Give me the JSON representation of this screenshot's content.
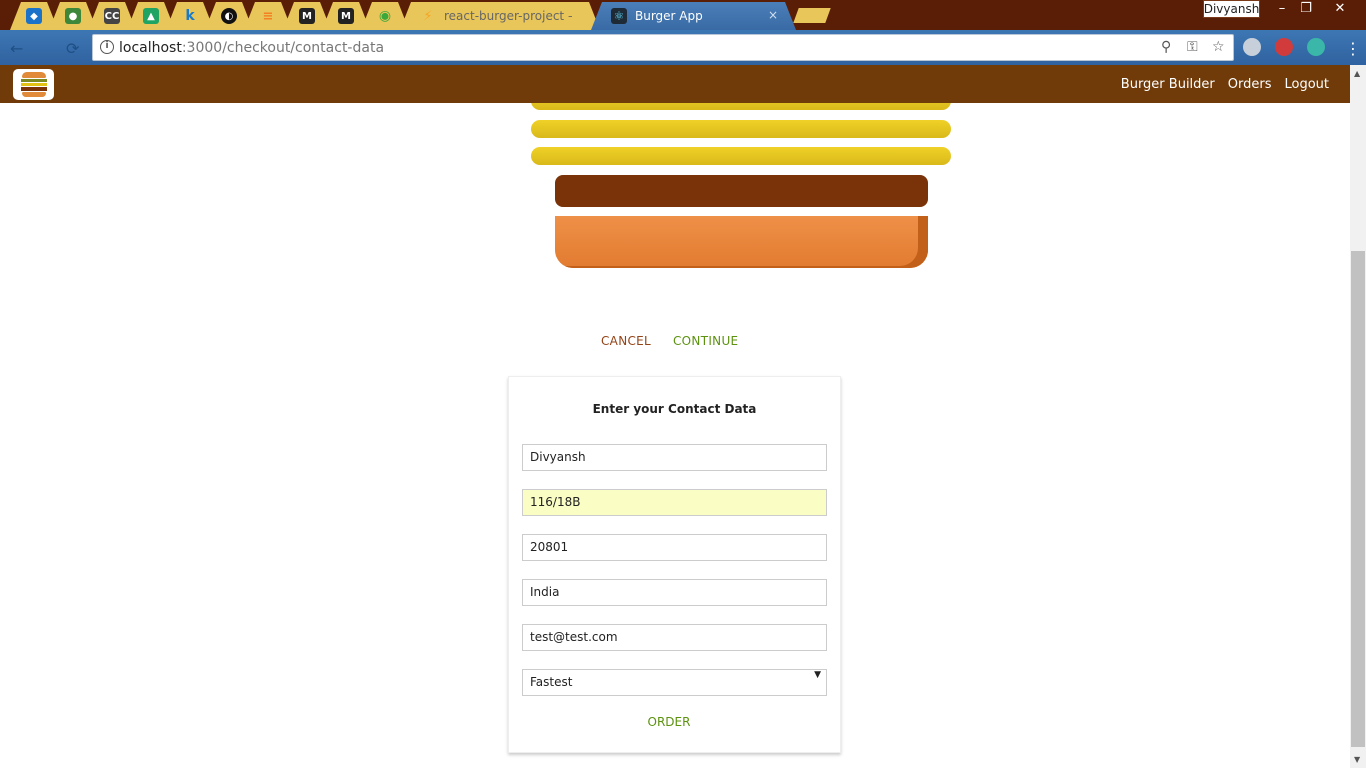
{
  "browser": {
    "tabs": [
      {
        "icon": "bird-favicon-icon",
        "title": ""
      },
      {
        "icon": "node-favicon-icon",
        "title": ""
      },
      {
        "icon": "cc-favicon-icon",
        "title": ""
      },
      {
        "icon": "drive-favicon-icon",
        "title": ""
      },
      {
        "icon": "k-favicon-icon",
        "title": ""
      },
      {
        "icon": "github-favicon-icon",
        "title": ""
      },
      {
        "icon": "stackoverflow-favicon-icon",
        "title": ""
      },
      {
        "icon": "medium-favicon-icon",
        "title": ""
      },
      {
        "icon": "medium-favicon-icon",
        "title": ""
      },
      {
        "icon": "circle-favicon-icon",
        "title": ""
      },
      {
        "icon": "firebase-favicon-icon",
        "title": "react-burger-project – D"
      },
      {
        "icon": "react-favicon-icon",
        "title": "Burger App",
        "active": true
      }
    ],
    "tab_glyphs": [
      "◆",
      "●",
      "CC",
      "▲",
      "k",
      "◐",
      "≡",
      "M",
      "M",
      "◉",
      "⚡",
      "⚛"
    ],
    "tab_close": "×",
    "profile_name": "Divyansh",
    "window_controls": {
      "minimize": "–",
      "restore": "❐",
      "close": "✕"
    },
    "nav": {
      "back": "←",
      "reload": "⟳"
    },
    "url_host": "localhost",
    "url_rest": ":3000/checkout/contact-data",
    "info_glyph": "i",
    "omni_icons": {
      "zoom": "⚲",
      "key": "⚿",
      "star": "☆"
    },
    "menu_glyph": "⋮"
  },
  "app": {
    "nav_items": [
      "Burger Builder",
      "Orders",
      "Logout"
    ],
    "controls": {
      "cancel": "CANCEL",
      "continue": "CONTINUE"
    },
    "form": {
      "title": "Enter your Contact Data",
      "name": "Divyansh",
      "street": "116/18B",
      "zip": "20801",
      "country": "India",
      "email": "test@test.com",
      "delivery_method": "Fastest",
      "order_label": "ORDER"
    }
  },
  "colors": {
    "toolbar": "#703b09",
    "cancel": "#944317",
    "continue": "#5c9210",
    "autofill": "#fafdc4"
  }
}
